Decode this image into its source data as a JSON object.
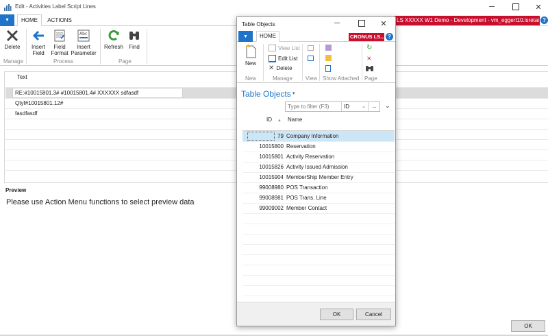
{
  "window": {
    "title": "Edit - Activities Label Script Lines"
  },
  "ribbon_tabs": {
    "home": "HOME",
    "actions": "ACTIONS"
  },
  "environment_banner": "LS XXXXX W1 Demo - Development - vm_eggert10.lsretai",
  "ribbon": {
    "delete": "Delete",
    "insert_field": [
      "Insert",
      "Field"
    ],
    "field_format": [
      "Field",
      "Format"
    ],
    "insert_parameter": [
      "Insert",
      "Parameter"
    ],
    "refresh": "Refresh",
    "find": "Find",
    "groups": {
      "manage": "Manage",
      "process": "Process",
      "page": "Page"
    }
  },
  "lines": {
    "header": "Text",
    "rows": [
      "RE:#10015801.3# #10015801.4# XXXXXX sdfasdf",
      "Qtyf#10015801.12#",
      "fasdfasdf"
    ]
  },
  "preview": {
    "label": "Preview",
    "message": "Please use Action Menu functions to select preview data"
  },
  "ok_label": "OK",
  "dialog": {
    "title": "Table Objects",
    "tab_home": "HOME",
    "company": "CRONUS LS...",
    "ribbon": {
      "new": "New",
      "view_list": "View List",
      "edit_list": "Edit List",
      "delete": "Delete",
      "groups": {
        "new": "New",
        "manage": "Manage",
        "view": "View",
        "show_attached": "Show Attached",
        "page": "Page"
      }
    },
    "heading": "Table Objects",
    "filter_placeholder": "Type to filter (F3)",
    "filter_field": "ID",
    "columns": {
      "id": "ID",
      "name": "Name"
    },
    "rows": [
      {
        "id": "79",
        "name": "Company Information"
      },
      {
        "id": "10015800",
        "name": "Reservation"
      },
      {
        "id": "10015801",
        "name": "Activity Reservation"
      },
      {
        "id": "10015826",
        "name": "Activity Issued Admission"
      },
      {
        "id": "10015904",
        "name": "MemberShip Member Entry"
      },
      {
        "id": "99008980",
        "name": "POS Transaction"
      },
      {
        "id": "99008981",
        "name": "POS Trans. Line"
      },
      {
        "id": "99009002",
        "name": "Member Contact"
      }
    ],
    "ok": "OK",
    "cancel": "Cancel"
  },
  "colors": {
    "accent": "#1f74c9",
    "banner": "#c8102e",
    "selection": "#cde6f7"
  }
}
